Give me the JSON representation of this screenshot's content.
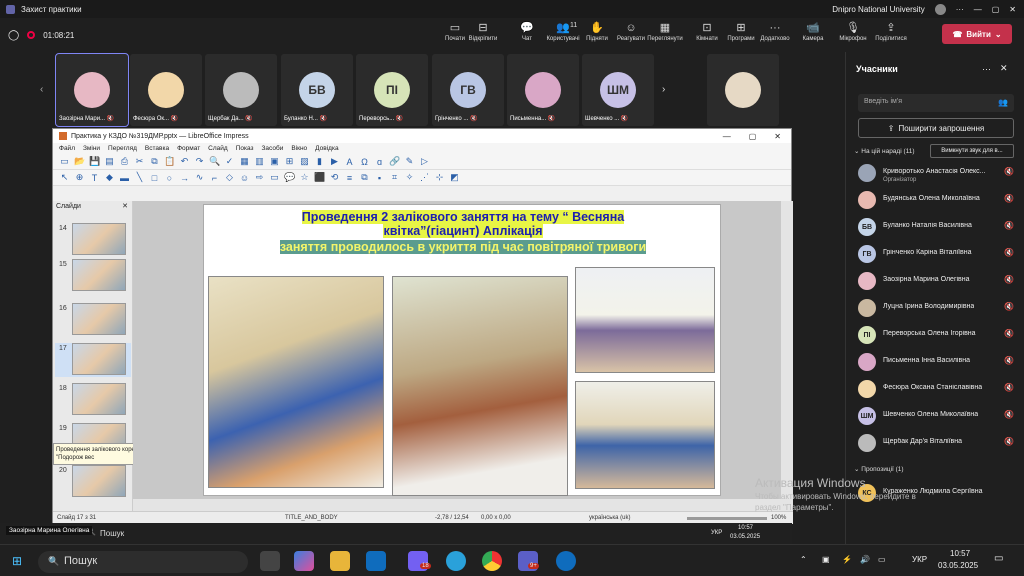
{
  "teams": {
    "window_title": "Захист практики",
    "org": "Dnipro National University",
    "timer": "01:08:21",
    "toolbar": [
      {
        "label": "Почати",
        "icon": "screen-icon"
      },
      {
        "label": "Відкріпити",
        "icon": "unpin-icon"
      },
      {
        "label": "Чат",
        "icon": "chat-icon"
      },
      {
        "label": "Користувачі",
        "icon": "people-icon",
        "count": "11"
      },
      {
        "label": "Підняти",
        "icon": "hand-icon"
      },
      {
        "label": "Реагувати",
        "icon": "smile-icon"
      },
      {
        "label": "Переглянути",
        "icon": "view-icon"
      },
      {
        "label": "Кімнати",
        "icon": "rooms-icon"
      },
      {
        "label": "Програми",
        "icon": "apps-icon"
      },
      {
        "label": "Додатково",
        "icon": "more-icon"
      },
      {
        "label": "Камера",
        "icon": "camera-icon"
      },
      {
        "label": "Мікрофон",
        "icon": "mic-icon"
      },
      {
        "label": "Поділитися",
        "icon": "share-icon"
      }
    ],
    "leave_label": "Вийти",
    "gallery": [
      {
        "name": "Заозірна Мари...",
        "initials": "",
        "color": "#e7b8c4"
      },
      {
        "name": "Фесюра Ок...",
        "initials": "",
        "color": "#f2d7a9"
      },
      {
        "name": "Щербак Да...",
        "initials": "",
        "color": "#bbbbbb"
      },
      {
        "name": "Буланко Н...",
        "initials": "БВ",
        "color": "#c4d4e8"
      },
      {
        "name": "Переворсь...",
        "initials": "ПІ",
        "color": "#d6e4b8"
      },
      {
        "name": "Грінченко ...",
        "initials": "ГВ",
        "color": "#b9c6e4"
      },
      {
        "name": "Письменна...",
        "initials": "",
        "color": "#d9a7c6"
      },
      {
        "name": "Шевченко ...",
        "initials": "ШМ",
        "color": "#c6c0e6"
      },
      {
        "name": "",
        "initials": "",
        "color": "#e6d9c5"
      }
    ]
  },
  "impress": {
    "title": "Практика у КЗДО №319ДМР.pptx — LibreOffice Impress",
    "menu": [
      "Файл",
      "Зміни",
      "Перегляд",
      "Вставка",
      "Формат",
      "Слайд",
      "Показ",
      "Засоби",
      "Вікно",
      "Довідка"
    ],
    "slides_label": "Слайди",
    "thumbs": [
      "14",
      "15",
      "16",
      "17",
      "18",
      "19",
      "20"
    ],
    "tooltip": "Проведення залікового корекційно-виховного заходу \"Подорож вес",
    "slide": {
      "line1": "Проведення  2 залікового заняття на тему “ Весняна",
      "line2": "квітка”(гіацинт) Аплікація",
      "line3": "заняття проводилось в укриття під час повітряної тривоги"
    },
    "status": {
      "slide": "Слайд 17 з 31",
      "layout": "TITLE_AND_BODY",
      "pos": "-2,78 / 12,54",
      "size": "0,00 x 0,00",
      "lang": "українська (uk)",
      "zoom": "100%"
    }
  },
  "people": {
    "title": "Учасники",
    "search_placeholder": "Введіть ім'я",
    "share_label": "Поширити запрошення",
    "in_meeting": "На цій нараді (11)",
    "mute_all": "Вимкнути звук для в...",
    "list": [
      {
        "name": "Криворотько Анастасія Олекс...",
        "sub": "Організатор",
        "initials": "",
        "color": "#9aa4b6"
      },
      {
        "name": "Будянська Олена Миколаївна",
        "sub": "",
        "initials": "",
        "color": "#e8b9b0"
      },
      {
        "name": "Буланко Наталія Василівна",
        "sub": "",
        "initials": "БВ",
        "color": "#c4d4e8"
      },
      {
        "name": "Грінченко Каріна Віталіївна",
        "sub": "",
        "initials": "ГВ",
        "color": "#b9c6e4"
      },
      {
        "name": "Заозірна Марина Олегівна",
        "sub": "",
        "initials": "",
        "color": "#e7b8c4"
      },
      {
        "name": "Луцна Ірина Володимирівна",
        "sub": "",
        "initials": "",
        "color": "#c9b8a0"
      },
      {
        "name": "Переворська Олена Ігорівна",
        "sub": "",
        "initials": "ПІ",
        "color": "#d6e4b8"
      },
      {
        "name": "Письменна Інна Василівна",
        "sub": "",
        "initials": "",
        "color": "#d9a7c6"
      },
      {
        "name": "Фесюра Оксана Станіславівна",
        "sub": "",
        "initials": "",
        "color": "#f2d7a9"
      },
      {
        "name": "Шевченко Олена Миколаївна",
        "sub": "",
        "initials": "ШМ",
        "color": "#c6c0e6"
      },
      {
        "name": "Щербак Дар'я Віталіївна",
        "sub": "",
        "initials": "",
        "color": "#bbbbbb"
      }
    ],
    "suggested": "Пропозиції (1)",
    "suggested_list": [
      {
        "name": "Кураженко Людмила Сергіївна",
        "initials": "КС",
        "color": "#f0c15a"
      }
    ]
  },
  "activation": {
    "line1": "Активация Windows",
    "line2": "Чтобы активировать Windows, перейдите в",
    "line3": "раздел \"Параметры\"."
  },
  "presenter_name": "Заозірна Марина Олегівна",
  "inner_taskbar": {
    "search": "Пошук",
    "time": "10:57",
    "date": "03.05.2025",
    "lang": "УКР"
  },
  "taskbar": {
    "search": "Пошук",
    "time": "10:57",
    "date": "03.05.2025",
    "lang": "УКР",
    "badge1": "18",
    "badge2": "9+"
  }
}
